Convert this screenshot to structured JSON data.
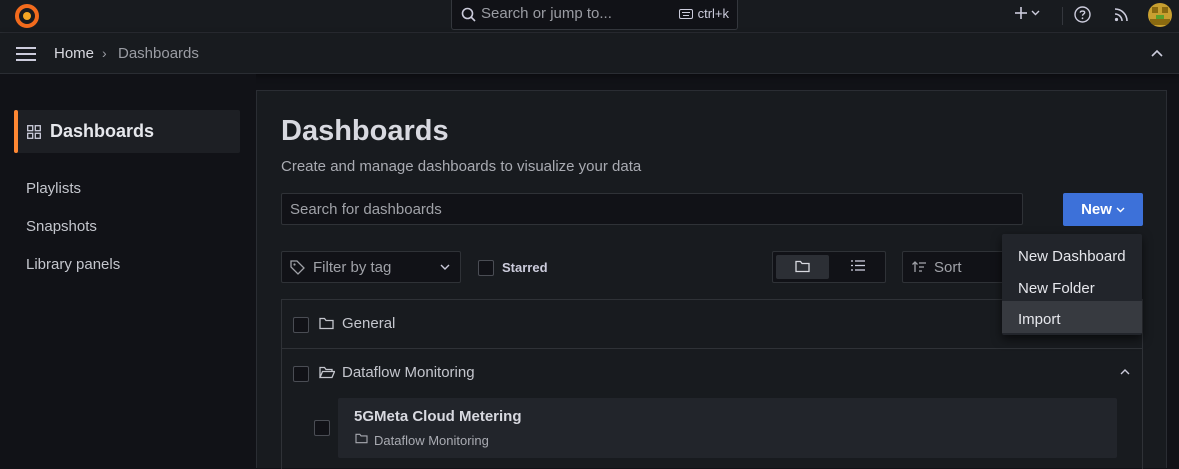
{
  "topbar": {
    "search_placeholder": "Search or jump to...",
    "search_shortcut": "ctrl+k"
  },
  "breadcrumb": {
    "home": "Home",
    "separator": "›",
    "current": "Dashboards"
  },
  "sidebar": {
    "active": "Dashboards",
    "items": [
      {
        "label": "Playlists"
      },
      {
        "label": "Snapshots"
      },
      {
        "label": "Library panels"
      }
    ]
  },
  "main": {
    "title": "Dashboards",
    "subtitle": "Create and manage dashboards to visualize your data",
    "search_placeholder": "Search for dashboards",
    "new_button": "New",
    "filter_by_tag": "Filter by tag",
    "starred_label": "Starred",
    "sort_label": "Sort",
    "folders": [
      {
        "name": "General"
      },
      {
        "name": "Dataflow Monitoring"
      }
    ],
    "dashboard": {
      "title": "5GMeta Cloud Metering",
      "folder": "Dataflow Monitoring"
    }
  },
  "new_menu": {
    "items": [
      "New Dashboard",
      "New Folder",
      "Import"
    ],
    "hovered": "Import"
  },
  "colors": {
    "accent_orange": "#ff8833",
    "primary_blue": "#3d71d9",
    "background": "#111217",
    "panel": "#181b1f"
  }
}
